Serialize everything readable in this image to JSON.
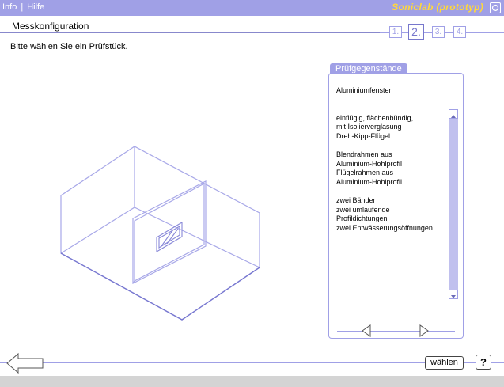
{
  "topbar": {
    "links": [
      {
        "label": "Info"
      },
      {
        "label": "Hilfe"
      }
    ],
    "separator": "|",
    "brand": "Soniclab (prototyp)",
    "colors": {
      "bar": "#a0a0e6",
      "brand": "#ffd83a"
    }
  },
  "titlebar": {
    "title": "Messkonfiguration"
  },
  "steps": [
    {
      "label": "1.",
      "active": false
    },
    {
      "label": "2.",
      "active": true
    },
    {
      "label": "3.",
      "active": false
    },
    {
      "label": "4.",
      "active": false
    }
  ],
  "instruction": "Bitte wählen Sie ein Prüfstück.",
  "panel": {
    "tab_label": "Prüfgegenstände",
    "paragraphs": [
      "Aluminiumfenster",
      "einflügig, flächenbündig,\nmit Isolierverglasung\nDreh-Kipp-Flügel",
      "Blendrahmen aus\nAluminium-Hohlprofil\nFlügelrahmen aus\nAluminium-Hohlprofil",
      "zwei Bänder\nzwei umlaufende\nProfildichtungen\nzwei Entwässerungsöffnungen"
    ],
    "icons": {
      "scroll_up": "triangle-up-icon",
      "scroll_down": "triangle-down-icon",
      "prev": "arrow-left-icon",
      "next": "arrow-right-icon"
    }
  },
  "footer": {
    "choose_label": "wählen",
    "help_label": "?"
  }
}
